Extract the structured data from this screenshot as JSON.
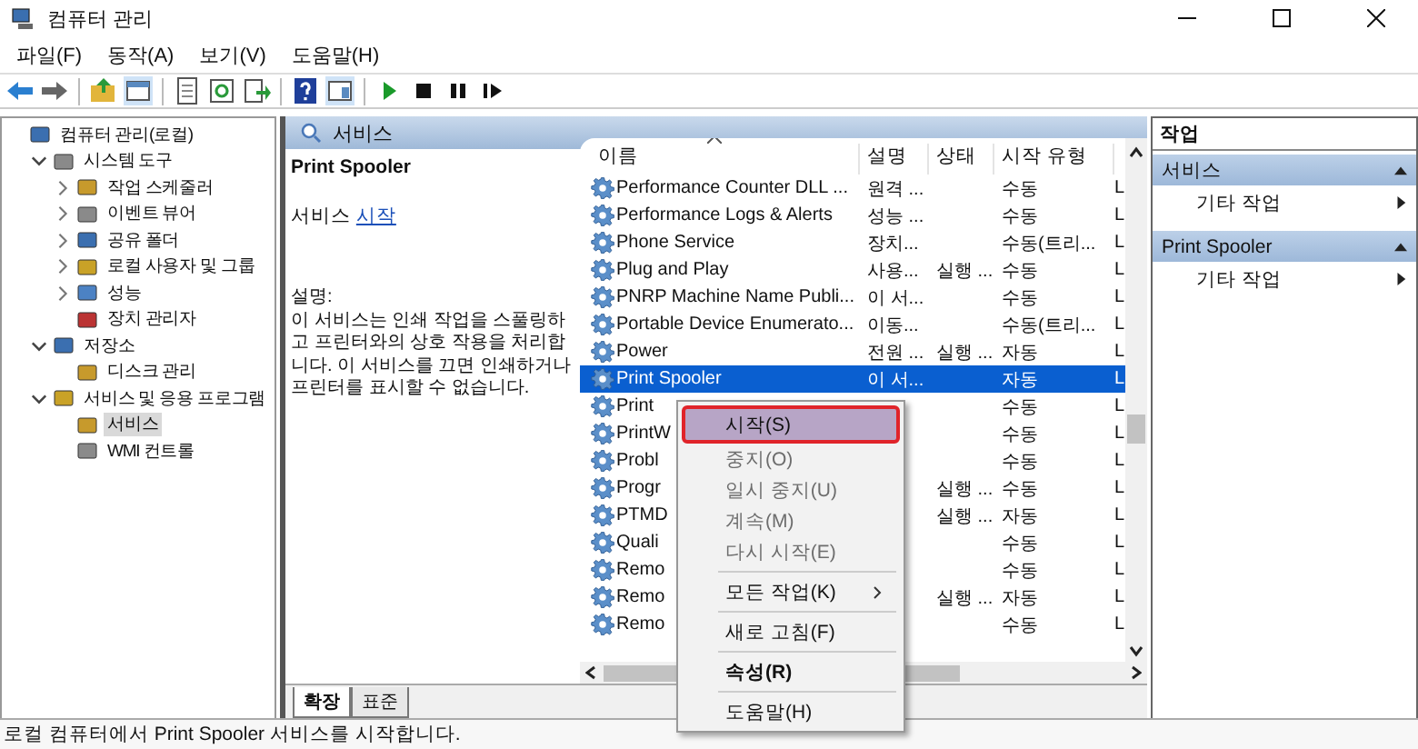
{
  "window": {
    "title": "컴퓨터 관리"
  },
  "menu": [
    "파일(F)",
    "동작(A)",
    "보기(V)",
    "도움말(H)"
  ],
  "tree": [
    {
      "label": "컴퓨터 관리(로컬)",
      "selected": false,
      "children": [
        {
          "label": "시스템 도구",
          "expanded": true,
          "selected": false,
          "children": [
            {
              "label": "작업 스케줄러",
              "expanded": false,
              "selected": false
            },
            {
              "label": "이벤트 뷰어",
              "expanded": false,
              "selected": false
            },
            {
              "label": "공유 폴더",
              "expanded": false,
              "selected": false
            },
            {
              "label": "로컬 사용자 및 그룹",
              "expanded": false,
              "selected": false
            },
            {
              "label": "성능",
              "expanded": false,
              "selected": false
            },
            {
              "label": "장치 관리자",
              "selected": false
            }
          ]
        },
        {
          "label": "저장소",
          "expanded": true,
          "selected": false,
          "children": [
            {
              "label": "디스크 관리",
              "selected": false
            }
          ]
        },
        {
          "label": "서비스 및 응용 프로그램",
          "expanded": true,
          "selected": false,
          "children": [
            {
              "label": "서비스",
              "selected": true
            },
            {
              "label": "WMI 컨트롤",
              "selected": false
            }
          ]
        }
      ]
    }
  ],
  "center": {
    "title": "서비스"
  },
  "details": {
    "name": "Print Spooler",
    "action_prefix": "서비스",
    "action_link": "시작",
    "description_label": "설명:",
    "description": "이 서비스는 인쇄 작업을 스풀링하고 프린터와의 상호 작용을 처리합니다. 이 서비스를 끄면 인쇄하거나 프린터를 표시할 수 없습니다."
  },
  "services": {
    "columns": [
      "이름",
      "설명",
      "상태",
      "시작 유형"
    ],
    "rows": [
      {
        "name": "Performance Counter DLL ...",
        "description": "원격 ...",
        "status": "",
        "startup": "수동",
        "column_5": "L",
        "selected": false
      },
      {
        "name": "Performance Logs & Alerts",
        "description": "성능 ...",
        "status": "",
        "startup": "수동",
        "column_5": "L",
        "selected": false
      },
      {
        "name": "Phone Service",
        "description": "장치...",
        "status": "",
        "startup": "수동(트리...",
        "column_5": "L",
        "selected": false
      },
      {
        "name": "Plug and Play",
        "description": "사용...",
        "status": "실행 ...",
        "startup": "수동",
        "column_5": "L",
        "selected": false
      },
      {
        "name": "PNRP Machine Name Publi...",
        "description": "이 서...",
        "status": "",
        "startup": "수동",
        "column_5": "L",
        "selected": false
      },
      {
        "name": "Portable Device Enumerato...",
        "description": "이동...",
        "status": "",
        "startup": "수동(트리...",
        "column_5": "L",
        "selected": false
      },
      {
        "name": "Power",
        "description": "전원 ...",
        "status": "실행 ...",
        "startup": "자동",
        "column_5": "L",
        "selected": false
      },
      {
        "name": "Print Spooler",
        "description": "이 서...",
        "status": "",
        "startup": "자동",
        "column_5": "L",
        "selected": true
      },
      {
        "name": "Print",
        "description": "",
        "status": "",
        "startup": "수동",
        "column_5": "L",
        "selected": false
      },
      {
        "name": "PrintW",
        "description": "",
        "status": "",
        "startup": "수동",
        "column_5": "L",
        "selected": false
      },
      {
        "name": "Probl",
        "description": "",
        "status": "",
        "startup": "수동",
        "column_5": "L",
        "selected": false
      },
      {
        "name": "Progr",
        "description": "",
        "status": "실행 ...",
        "startup": "수동",
        "column_5": "L",
        "selected": false
      },
      {
        "name": "PTMD",
        "description": "",
        "status": "실행 ...",
        "startup": "자동",
        "column_5": "L",
        "selected": false
      },
      {
        "name": "Quali",
        "description": "",
        "status": "",
        "startup": "수동",
        "column_5": "L",
        "selected": false
      },
      {
        "name": "Remo",
        "description": "",
        "status": "",
        "startup": "수동",
        "column_5": "L",
        "selected": false
      },
      {
        "name": "Remo",
        "description": "",
        "status": "실행 ...",
        "startup": "자동",
        "column_5": "L",
        "selected": false
      },
      {
        "name": "Remo",
        "description": "",
        "status": "",
        "startup": "수동",
        "column_5": "L",
        "selected": false
      }
    ]
  },
  "context_menu": {
    "items": [
      {
        "kind": "item",
        "label": "시작(S)",
        "selected": true,
        "disabled": false
      },
      {
        "kind": "item",
        "label": "중지(O)",
        "selected": false,
        "disabled": true
      },
      {
        "kind": "item",
        "label": "일시 중지(U)",
        "selected": false,
        "disabled": true
      },
      {
        "kind": "item",
        "label": "계속(M)",
        "selected": false,
        "disabled": true
      },
      {
        "kind": "item",
        "label": "다시 시작(E)",
        "selected": false,
        "disabled": true
      },
      {
        "kind": "separator"
      },
      {
        "kind": "submenu",
        "label": "모든 작업(K)",
        "selected": false,
        "disabled": false
      },
      {
        "kind": "separator"
      },
      {
        "kind": "item",
        "label": "새로 고침(F)",
        "selected": false,
        "disabled": false
      },
      {
        "kind": "separator"
      },
      {
        "kind": "default",
        "label": "속성(R)",
        "selected": false,
        "disabled": false
      },
      {
        "kind": "separator"
      },
      {
        "kind": "item",
        "label": "도움말(H)",
        "selected": false,
        "disabled": false
      }
    ]
  },
  "view_tabs": [
    {
      "label": "확장",
      "selected": true
    },
    {
      "label": "표준",
      "selected": false
    }
  ],
  "actions": {
    "title": "작업",
    "sections": [
      {
        "title": "서비스",
        "expanded": true,
        "items": [
          "기타 작업"
        ]
      },
      {
        "title": "Print Spooler",
        "expanded": true,
        "items": [
          "기타 작업"
        ]
      }
    ]
  },
  "status_bar": "로컬 컴퓨터에서 Print Spooler 서비스를 시작합니다."
}
